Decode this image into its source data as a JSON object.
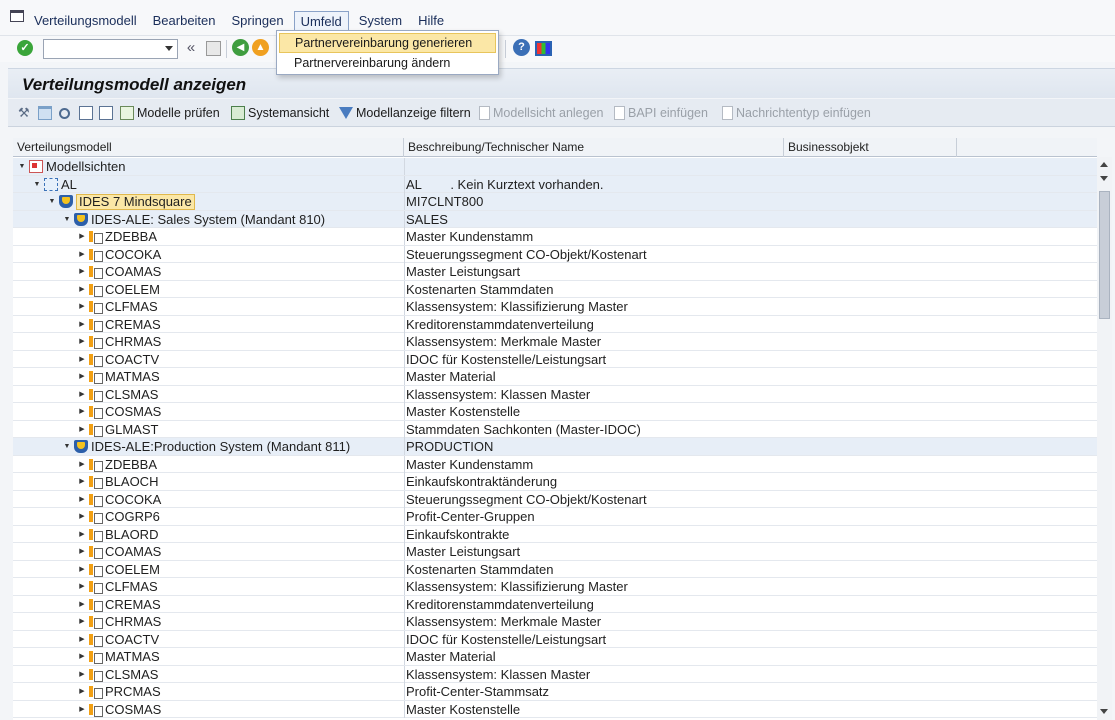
{
  "menubar": {
    "items": [
      "Verteilungsmodell",
      "Bearbeiten",
      "Springen",
      "Umfeld",
      "System",
      "Hilfe"
    ]
  },
  "dropdown": {
    "items": [
      "Partnervereinbarung generieren",
      "Partnervereinbarung ändern"
    ]
  },
  "toolbar": {
    "command_value": "",
    "back_glyph": "«"
  },
  "title": "Verteilungsmodell anzeigen",
  "app_toolbar": {
    "check_models": "Modelle prüfen",
    "system_view": "Systemansicht",
    "filter_display": "Modellanzeige filtern",
    "create_view": "Modellsicht anlegen",
    "insert_bapi": "BAPI einfügen",
    "insert_msgtype": "Nachrichtentyp einfügen"
  },
  "table": {
    "columns": [
      "Verteilungsmodell",
      "Beschreibung/Technischer Name",
      "Businessobjekt"
    ],
    "rows": [
      {
        "level": 0,
        "icon": "folder",
        "name": "Modellsichten",
        "desc": "",
        "group": true
      },
      {
        "level": 1,
        "icon": "net",
        "name": "AL",
        "desc": "AL        . Kein Kurztext vorhanden.",
        "group": true
      },
      {
        "level": 2,
        "icon": "shield",
        "name": "IDES 7 Mindsquare",
        "desc": "MI7CLNT800",
        "group": true,
        "highlight": true
      },
      {
        "level": 3,
        "icon": "shield",
        "name": "IDES-ALE: Sales System (Mandant 810)",
        "desc": "SALES",
        "group": true
      },
      {
        "level": 4,
        "icon": "msg",
        "name": "ZDEBBA",
        "desc": "Master Kundenstamm"
      },
      {
        "level": 4,
        "icon": "msg",
        "name": "COCOKA",
        "desc": "Steuerungssegment CO-Objekt/Kostenart"
      },
      {
        "level": 4,
        "icon": "msg",
        "name": "COAMAS",
        "desc": "Master Leistungsart"
      },
      {
        "level": 4,
        "icon": "msg",
        "name": "COELEM",
        "desc": "Kostenarten Stammdaten"
      },
      {
        "level": 4,
        "icon": "msg",
        "name": "CLFMAS",
        "desc": "Klassensystem: Klassifizierung Master"
      },
      {
        "level": 4,
        "icon": "msg",
        "name": "CREMAS",
        "desc": "Kreditorenstammdatenverteilung"
      },
      {
        "level": 4,
        "icon": "msg",
        "name": "CHRMAS",
        "desc": "Klassensystem: Merkmale Master"
      },
      {
        "level": 4,
        "icon": "msg",
        "name": "COACTV",
        "desc": "IDOC für Kostenstelle/Leistungsart"
      },
      {
        "level": 4,
        "icon": "msg",
        "name": "MATMAS",
        "desc": "Master Material"
      },
      {
        "level": 4,
        "icon": "msg",
        "name": "CLSMAS",
        "desc": "Klassensystem: Klassen Master"
      },
      {
        "level": 4,
        "icon": "msg",
        "name": "COSMAS",
        "desc": "Master Kostenstelle"
      },
      {
        "level": 4,
        "icon": "msg",
        "name": "GLMAST",
        "desc": "Stammdaten Sachkonten (Master-IDOC)"
      },
      {
        "level": 3,
        "icon": "shield",
        "name": "IDES-ALE:Production System (Mandant 811)",
        "desc": "PRODUCTION",
        "group": true
      },
      {
        "level": 4,
        "icon": "msg",
        "name": "ZDEBBA",
        "desc": "Master Kundenstamm"
      },
      {
        "level": 4,
        "icon": "msg",
        "name": "BLAOCH",
        "desc": "Einkaufskontraktänderung"
      },
      {
        "level": 4,
        "icon": "msg",
        "name": "COCOKA",
        "desc": "Steuerungssegment CO-Objekt/Kostenart"
      },
      {
        "level": 4,
        "icon": "msg",
        "name": "COGRP6",
        "desc": "Profit-Center-Gruppen"
      },
      {
        "level": 4,
        "icon": "msg",
        "name": "BLAORD",
        "desc": "Einkaufskontrakte"
      },
      {
        "level": 4,
        "icon": "msg",
        "name": "COAMAS",
        "desc": "Master Leistungsart"
      },
      {
        "level": 4,
        "icon": "msg",
        "name": "COELEM",
        "desc": "Kostenarten Stammdaten"
      },
      {
        "level": 4,
        "icon": "msg",
        "name": "CLFMAS",
        "desc": "Klassensystem: Klassifizierung Master"
      },
      {
        "level": 4,
        "icon": "msg",
        "name": "CREMAS",
        "desc": "Kreditorenstammdatenverteilung"
      },
      {
        "level": 4,
        "icon": "msg",
        "name": "CHRMAS",
        "desc": "Klassensystem: Merkmale Master"
      },
      {
        "level": 4,
        "icon": "msg",
        "name": "COACTV",
        "desc": "IDOC für Kostenstelle/Leistungsart"
      },
      {
        "level": 4,
        "icon": "msg",
        "name": "MATMAS",
        "desc": "Master Material"
      },
      {
        "level": 4,
        "icon": "msg",
        "name": "CLSMAS",
        "desc": "Klassensystem: Klassen Master"
      },
      {
        "level": 4,
        "icon": "msg",
        "name": "PRCMAS",
        "desc": "Profit-Center-Stammsatz"
      },
      {
        "level": 4,
        "icon": "msg",
        "name": "COSMAS",
        "desc": "Master Kostenstelle"
      }
    ]
  }
}
